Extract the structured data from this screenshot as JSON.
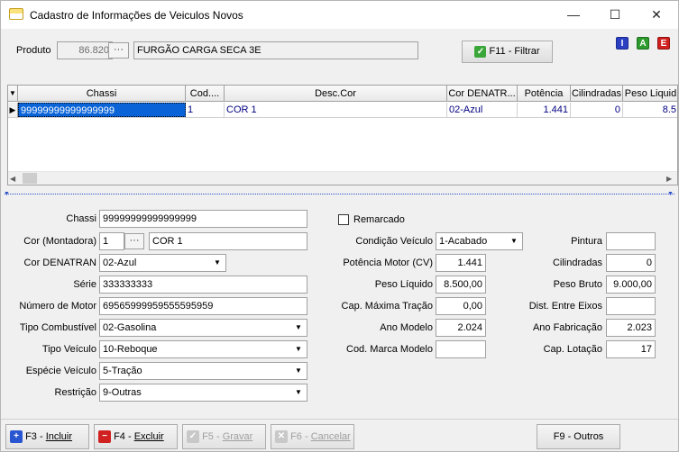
{
  "window": {
    "title": "Cadastro de Informações de Veiculos Novos",
    "minimize": "—",
    "maximize": "☐",
    "close": "✕"
  },
  "product": {
    "label": "Produto",
    "code": "86.820",
    "lookup_btn": "···",
    "description": "FURGÃO CARGA SECA 3E"
  },
  "filter_button": "F11 - Filtrar",
  "mode_buttons": {
    "insert": "I",
    "alter": "A",
    "exclude": "E"
  },
  "grid": {
    "columns": [
      "Chassi",
      "Cod....",
      "Desc.Cor",
      "Cor DENATR...",
      "Potência",
      "Cilindradas",
      "Peso Liquid"
    ],
    "rows": [
      [
        "99999999999999999",
        "1",
        "COR 1",
        "02-Azul",
        "1.441",
        "0",
        "8.5"
      ]
    ]
  },
  "form": {
    "chassi_label": "Chassi",
    "chassi": "99999999999999999",
    "cor_montadora_label": "Cor (Montadora)",
    "cor_montadora_code": "1",
    "cor_montadora_btn": "···",
    "cor_montadora_desc": "COR 1",
    "cor_denatran_label": "Cor DENATRAN",
    "cor_denatran": "02-Azul",
    "serie_label": "Série",
    "serie": "333333333",
    "numero_motor_label": "Número de Motor",
    "numero_motor": "69565999959555595959",
    "tipo_combustivel_label": "Tipo Combustível",
    "tipo_combustivel": "02-Gasolina",
    "tipo_veiculo_label": "Tipo Veículo",
    "tipo_veiculo": "10-Reboque",
    "especie_veiculo_label": "Espécie Veículo",
    "especie_veiculo": "5-Tração",
    "restricao_label": "Restrição",
    "restricao": "9-Outras",
    "remarcado_label": "Remarcado",
    "condicao_label": "Condição Veículo",
    "condicao": "1-Acabado",
    "potencia_label": "Potência Motor (CV)",
    "potencia": "1.441",
    "peso_liquido_label": "Peso Líquido",
    "peso_liquido": "8.500,00",
    "cap_tracao_label": "Cap. Máxima Tração",
    "cap_tracao": "0,00",
    "ano_modelo_label": "Ano Modelo",
    "ano_modelo": "2.024",
    "cod_marca_label": "Cod. Marca Modelo",
    "cod_marca": "",
    "pintura_label": "Pintura",
    "pintura": "",
    "cilindradas_label": "Cilindradas",
    "cilindradas": "0",
    "peso_bruto_label": "Peso Bruto",
    "peso_bruto": "9.000,00",
    "dist_eixos_label": "Dist. Entre Eixos",
    "dist_eixos": "",
    "ano_fabricacao_label": "Ano Fabricação",
    "ano_fabricacao": "2.023",
    "cap_lotacao_label": "Cap. Lotação",
    "cap_lotacao": "17"
  },
  "bottom": {
    "incluir_key": "F3 - ",
    "incluir": "Incluir",
    "excluir_key": "F4 - ",
    "excluir": "Excluir",
    "gravar_key": "F5 - ",
    "gravar": "Gravar",
    "cancelar_key": "F6 - ",
    "cancelar": "Cancelar",
    "outros": "F9 - Outros"
  }
}
